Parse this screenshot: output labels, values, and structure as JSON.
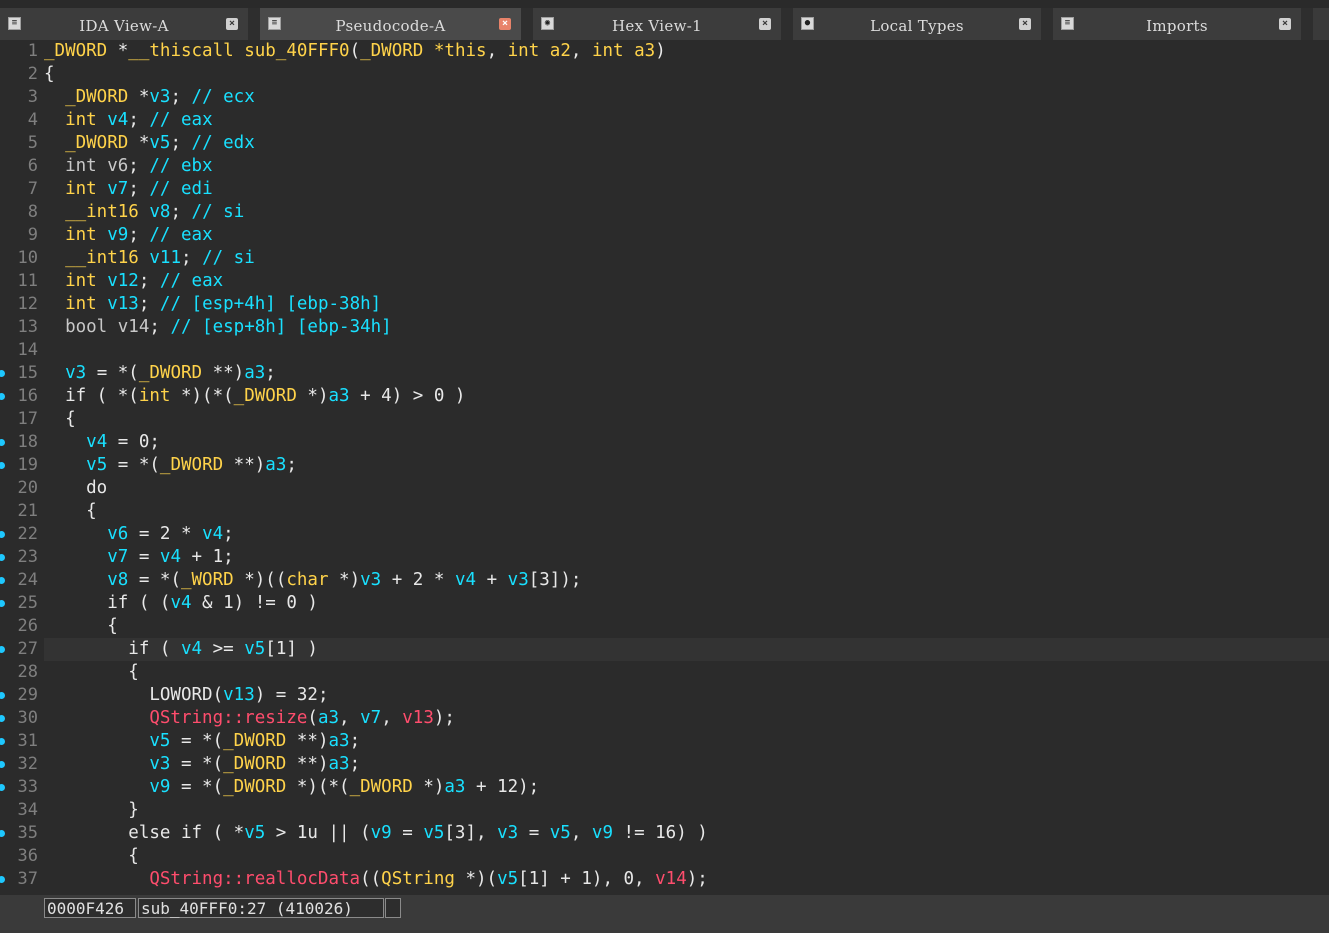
{
  "tabs": [
    {
      "label": "IDA View-A",
      "icon": "ida-view-icon",
      "active": false
    },
    {
      "label": "Pseudocode-A",
      "icon": "pseudocode-icon",
      "active": true
    },
    {
      "label": "Hex View-1",
      "icon": "hex-view-icon",
      "active": false
    },
    {
      "label": "Local Types",
      "icon": "local-types-icon",
      "active": false
    },
    {
      "label": "Imports",
      "icon": "imports-icon",
      "active": false
    }
  ],
  "code_lines": [
    {
      "n": "1",
      "bp": false,
      "hl": false,
      "tokens": [
        [
          "type",
          "_DWORD"
        ],
        [
          "txt",
          " *"
        ],
        [
          "type",
          "__thiscall"
        ],
        [
          "txt",
          " "
        ],
        [
          "type",
          "sub_40FFF0"
        ],
        [
          "txt",
          "("
        ],
        [
          "type",
          "_DWORD"
        ],
        [
          "txt",
          " "
        ],
        [
          "type",
          "*this"
        ],
        [
          "txt",
          ", "
        ],
        [
          "type",
          "int"
        ],
        [
          "txt",
          " "
        ],
        [
          "type",
          "a2"
        ],
        [
          "txt",
          ", "
        ],
        [
          "type",
          "int"
        ],
        [
          "txt",
          " "
        ],
        [
          "type",
          "a3"
        ],
        [
          "txt",
          ")"
        ]
      ]
    },
    {
      "n": "2",
      "bp": false,
      "hl": false,
      "tokens": [
        [
          "txt",
          "{"
        ]
      ]
    },
    {
      "n": "3",
      "bp": false,
      "hl": false,
      "tokens": [
        [
          "txt",
          "  "
        ],
        [
          "type",
          "_DWORD"
        ],
        [
          "txt",
          " *"
        ],
        [
          "var",
          "v3"
        ],
        [
          "txt",
          "; "
        ],
        [
          "cmt",
          "// ecx"
        ]
      ]
    },
    {
      "n": "4",
      "bp": false,
      "hl": false,
      "tokens": [
        [
          "txt",
          "  "
        ],
        [
          "type",
          "int"
        ],
        [
          "txt",
          " "
        ],
        [
          "var",
          "v4"
        ],
        [
          "txt",
          "; "
        ],
        [
          "cmt",
          "// eax"
        ]
      ]
    },
    {
      "n": "5",
      "bp": false,
      "hl": false,
      "tokens": [
        [
          "txt",
          "  "
        ],
        [
          "type",
          "_DWORD"
        ],
        [
          "txt",
          " *"
        ],
        [
          "var",
          "v5"
        ],
        [
          "txt",
          "; "
        ],
        [
          "cmt",
          "// edx"
        ]
      ]
    },
    {
      "n": "6",
      "bp": false,
      "hl": false,
      "tokens": [
        [
          "txt",
          "  "
        ],
        [
          "bool",
          "int v6"
        ],
        [
          "txt",
          "; "
        ],
        [
          "cmt",
          "// ebx"
        ]
      ]
    },
    {
      "n": "7",
      "bp": false,
      "hl": false,
      "tokens": [
        [
          "txt",
          "  "
        ],
        [
          "type",
          "int"
        ],
        [
          "txt",
          " "
        ],
        [
          "var",
          "v7"
        ],
        [
          "txt",
          "; "
        ],
        [
          "cmt",
          "// edi"
        ]
      ]
    },
    {
      "n": "8",
      "bp": false,
      "hl": false,
      "tokens": [
        [
          "txt",
          "  "
        ],
        [
          "type",
          "__int16"
        ],
        [
          "txt",
          " "
        ],
        [
          "var",
          "v8"
        ],
        [
          "txt",
          "; "
        ],
        [
          "cmt",
          "// si"
        ]
      ]
    },
    {
      "n": "9",
      "bp": false,
      "hl": false,
      "tokens": [
        [
          "txt",
          "  "
        ],
        [
          "type",
          "int"
        ],
        [
          "txt",
          " "
        ],
        [
          "var",
          "v9"
        ],
        [
          "txt",
          "; "
        ],
        [
          "cmt",
          "// eax"
        ]
      ]
    },
    {
      "n": "10",
      "bp": false,
      "hl": false,
      "tokens": [
        [
          "txt",
          "  "
        ],
        [
          "type",
          "__int16"
        ],
        [
          "txt",
          " "
        ],
        [
          "var",
          "v11"
        ],
        [
          "txt",
          "; "
        ],
        [
          "cmt",
          "// si"
        ]
      ]
    },
    {
      "n": "11",
      "bp": false,
      "hl": false,
      "tokens": [
        [
          "txt",
          "  "
        ],
        [
          "type",
          "int"
        ],
        [
          "txt",
          " "
        ],
        [
          "var",
          "v12"
        ],
        [
          "txt",
          "; "
        ],
        [
          "cmt",
          "// eax"
        ]
      ]
    },
    {
      "n": "12",
      "bp": false,
      "hl": false,
      "tokens": [
        [
          "txt",
          "  "
        ],
        [
          "type",
          "int"
        ],
        [
          "txt",
          " "
        ],
        [
          "var",
          "v13"
        ],
        [
          "txt",
          "; "
        ],
        [
          "cmt",
          "// [esp+4h] [ebp-38h]"
        ]
      ]
    },
    {
      "n": "13",
      "bp": false,
      "hl": false,
      "tokens": [
        [
          "txt",
          "  "
        ],
        [
          "bool",
          "bool v14"
        ],
        [
          "txt",
          "; "
        ],
        [
          "cmt",
          "// [esp+8h] [ebp-34h]"
        ]
      ]
    },
    {
      "n": "14",
      "bp": false,
      "hl": false,
      "tokens": []
    },
    {
      "n": "15",
      "bp": true,
      "hl": false,
      "tokens": [
        [
          "txt",
          "  "
        ],
        [
          "var",
          "v3"
        ],
        [
          "txt",
          " = *("
        ],
        [
          "type",
          "_DWORD"
        ],
        [
          "txt",
          " **)"
        ],
        [
          "var",
          "a3"
        ],
        [
          "txt",
          ";"
        ]
      ]
    },
    {
      "n": "16",
      "bp": true,
      "hl": false,
      "tokens": [
        [
          "txt",
          "  if ( *("
        ],
        [
          "type",
          "int"
        ],
        [
          "txt",
          " *)(*("
        ],
        [
          "type",
          "_DWORD"
        ],
        [
          "txt",
          " *)"
        ],
        [
          "var",
          "a3"
        ],
        [
          "txt",
          " + 4) > 0 )"
        ]
      ]
    },
    {
      "n": "17",
      "bp": false,
      "hl": false,
      "tokens": [
        [
          "txt",
          "  {"
        ]
      ]
    },
    {
      "n": "18",
      "bp": true,
      "hl": false,
      "tokens": [
        [
          "txt",
          "    "
        ],
        [
          "var",
          "v4"
        ],
        [
          "txt",
          " = 0;"
        ]
      ]
    },
    {
      "n": "19",
      "bp": true,
      "hl": false,
      "tokens": [
        [
          "txt",
          "    "
        ],
        [
          "var",
          "v5"
        ],
        [
          "txt",
          " = *("
        ],
        [
          "type",
          "_DWORD"
        ],
        [
          "txt",
          " **)"
        ],
        [
          "var",
          "a3"
        ],
        [
          "txt",
          ";"
        ]
      ]
    },
    {
      "n": "20",
      "bp": false,
      "hl": false,
      "tokens": [
        [
          "txt",
          "    do"
        ]
      ]
    },
    {
      "n": "21",
      "bp": false,
      "hl": false,
      "tokens": [
        [
          "txt",
          "    {"
        ]
      ]
    },
    {
      "n": "22",
      "bp": true,
      "hl": false,
      "tokens": [
        [
          "txt",
          "      "
        ],
        [
          "var",
          "v6"
        ],
        [
          "txt",
          " = 2 * "
        ],
        [
          "var",
          "v4"
        ],
        [
          "txt",
          ";"
        ]
      ]
    },
    {
      "n": "23",
      "bp": true,
      "hl": false,
      "tokens": [
        [
          "txt",
          "      "
        ],
        [
          "var",
          "v7"
        ],
        [
          "txt",
          " = "
        ],
        [
          "var",
          "v4"
        ],
        [
          "txt",
          " + 1;"
        ]
      ]
    },
    {
      "n": "24",
      "bp": true,
      "hl": false,
      "tokens": [
        [
          "txt",
          "      "
        ],
        [
          "var",
          "v8"
        ],
        [
          "txt",
          " = *("
        ],
        [
          "type",
          "_WORD"
        ],
        [
          "txt",
          " *)(("
        ],
        [
          "type",
          "char"
        ],
        [
          "txt",
          " *)"
        ],
        [
          "var",
          "v3"
        ],
        [
          "txt",
          " + 2 * "
        ],
        [
          "var",
          "v4"
        ],
        [
          "txt",
          " + "
        ],
        [
          "var",
          "v3"
        ],
        [
          "txt",
          "[3]);"
        ]
      ]
    },
    {
      "n": "25",
      "bp": true,
      "hl": false,
      "tokens": [
        [
          "txt",
          "      if ( ("
        ],
        [
          "var",
          "v4"
        ],
        [
          "txt",
          " & 1) != 0 )"
        ]
      ]
    },
    {
      "n": "26",
      "bp": false,
      "hl": false,
      "tokens": [
        [
          "txt",
          "      {"
        ]
      ]
    },
    {
      "n": "27",
      "bp": true,
      "hl": true,
      "tokens": [
        [
          "txt",
          "        if ( "
        ],
        [
          "var",
          "v4"
        ],
        [
          "txt",
          " >= "
        ],
        [
          "var",
          "v5"
        ],
        [
          "txt",
          "[1] )"
        ]
      ]
    },
    {
      "n": "28",
      "bp": false,
      "hl": false,
      "tokens": [
        [
          "txt",
          "        {"
        ]
      ]
    },
    {
      "n": "29",
      "bp": true,
      "hl": false,
      "tokens": [
        [
          "txt",
          "          LOWORD("
        ],
        [
          "var",
          "v13"
        ],
        [
          "txt",
          ") = 32;"
        ]
      ]
    },
    {
      "n": "30",
      "bp": true,
      "hl": false,
      "tokens": [
        [
          "txt",
          "          "
        ],
        [
          "func",
          "QString::resize"
        ],
        [
          "txt",
          "("
        ],
        [
          "var",
          "a3"
        ],
        [
          "txt",
          ", "
        ],
        [
          "var",
          "v7"
        ],
        [
          "txt",
          ", "
        ],
        [
          "func",
          "v13"
        ],
        [
          "txt",
          ");"
        ]
      ]
    },
    {
      "n": "31",
      "bp": true,
      "hl": false,
      "tokens": [
        [
          "txt",
          "          "
        ],
        [
          "var",
          "v5"
        ],
        [
          "txt",
          " = *("
        ],
        [
          "type",
          "_DWORD"
        ],
        [
          "txt",
          " **)"
        ],
        [
          "var",
          "a3"
        ],
        [
          "txt",
          ";"
        ]
      ]
    },
    {
      "n": "32",
      "bp": true,
      "hl": false,
      "tokens": [
        [
          "txt",
          "          "
        ],
        [
          "var",
          "v3"
        ],
        [
          "txt",
          " = *("
        ],
        [
          "type",
          "_DWORD"
        ],
        [
          "txt",
          " **)"
        ],
        [
          "var",
          "a3"
        ],
        [
          "txt",
          ";"
        ]
      ]
    },
    {
      "n": "33",
      "bp": true,
      "hl": false,
      "tokens": [
        [
          "txt",
          "          "
        ],
        [
          "var",
          "v9"
        ],
        [
          "txt",
          " = *("
        ],
        [
          "type",
          "_DWORD"
        ],
        [
          "txt",
          " *)(*("
        ],
        [
          "type",
          "_DWORD"
        ],
        [
          "txt",
          " *)"
        ],
        [
          "var",
          "a3"
        ],
        [
          "txt",
          " + 12);"
        ]
      ]
    },
    {
      "n": "34",
      "bp": false,
      "hl": false,
      "tokens": [
        [
          "txt",
          "        }"
        ]
      ]
    },
    {
      "n": "35",
      "bp": true,
      "hl": false,
      "tokens": [
        [
          "txt",
          "        else if ( *"
        ],
        [
          "var",
          "v5"
        ],
        [
          "txt",
          " > 1u || ("
        ],
        [
          "var",
          "v9"
        ],
        [
          "txt",
          " = "
        ],
        [
          "var",
          "v5"
        ],
        [
          "txt",
          "[3], "
        ],
        [
          "var",
          "v3"
        ],
        [
          "txt",
          " = "
        ],
        [
          "var",
          "v5"
        ],
        [
          "txt",
          ", "
        ],
        [
          "var",
          "v9"
        ],
        [
          "txt",
          " != 16) )"
        ]
      ]
    },
    {
      "n": "36",
      "bp": false,
      "hl": false,
      "tokens": [
        [
          "txt",
          "        {"
        ]
      ]
    },
    {
      "n": "37",
      "bp": true,
      "hl": false,
      "tokens": [
        [
          "txt",
          "          "
        ],
        [
          "func",
          "QString::reallocData"
        ],
        [
          "txt",
          "(("
        ],
        [
          "type",
          "QString"
        ],
        [
          "txt",
          " *)("
        ],
        [
          "var",
          "v5"
        ],
        [
          "txt",
          "[1] + 1), 0, "
        ],
        [
          "func",
          "v14"
        ],
        [
          "txt",
          ");"
        ]
      ]
    }
  ],
  "status": {
    "address": "0000F426",
    "location": "sub_40FFF0:27 (410026)"
  }
}
